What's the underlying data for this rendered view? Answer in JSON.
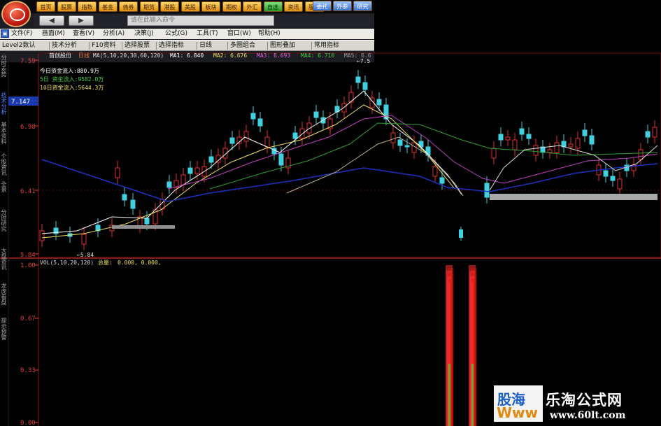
{
  "top_nav": {
    "buttons": [
      "首页",
      "股票",
      "指数",
      "基金",
      "债券",
      "期货",
      "港股",
      "美股",
      "板块",
      "期权",
      "外汇",
      "自选",
      "资讯",
      "服务"
    ],
    "extra_buttons": [
      "委托",
      "外参",
      "研究"
    ]
  },
  "address_bar": {
    "back_label": "◀",
    "forward_label": "▶",
    "command_placeholder": "请在此输入命令"
  },
  "menu": {
    "items": [
      "文件(F)",
      "画面(M)",
      "查看(V)",
      "分析(A)",
      "决策(J)",
      "公式(G)",
      "工具(T)",
      "窗口(W)",
      "帮助(H)"
    ]
  },
  "toolbar": {
    "items": [
      "Level2数认",
      "技术分析",
      "F10资料",
      "选择股票",
      "选择指标",
      "日线",
      "多图组合",
      "图形叠加",
      "常用指标"
    ]
  },
  "side_tabs": [
    "分时走势",
    "技术分析",
    "基本资料",
    "个股资讯",
    "全景",
    "分时研究",
    "大盘资讯",
    "龙虎看盘",
    "提示预警"
  ],
  "price_panel": {
    "stock_name": "首创股份",
    "period": "日线",
    "ma_spec": "MA(5,10,20,30,60,120)",
    "ma_values": [
      {
        "label": "MA1:",
        "value": "6.840",
        "color": "#ffffff"
      },
      {
        "label": "MA2:",
        "value": "6.676",
        "color": "#f0e060"
      },
      {
        "label": "MA3:",
        "value": "6.693",
        "color": "#e060e0"
      },
      {
        "label": "MA4:",
        "value": "6.710",
        "color": "#40d040"
      },
      {
        "label": "MA5:",
        "value": "6.6",
        "color": "#a0a0a0"
      }
    ],
    "fund_flow": [
      {
        "text": "今日资金流入:880.9万",
        "color": "#ffffff"
      },
      {
        "text": "5日 资金流入:9582.0万",
        "color": "#40d040"
      },
      {
        "text": "10日资金流入:5644.3万",
        "color": "#f0e060"
      }
    ],
    "price_axis": [
      "7.59",
      "6.98",
      "6.41",
      "5.84"
    ],
    "current_price": "7.147",
    "high_marker": "7.5",
    "low_marker": "5.84"
  },
  "volume_panel": {
    "spec": "VOL(5,10,20,120)",
    "label": "总量:",
    "values": "0.000, 0.000,",
    "axis": [
      "1.00",
      "0.67",
      "0.33",
      "0.00"
    ]
  },
  "watermark": {
    "logo_top": "股海",
    "logo_bottom": "Www",
    "site_name": "乐淘公式网",
    "url": "www.60lt.com"
  },
  "colors": {
    "up_candle": "#e03030",
    "down_candle": "#40d0e0",
    "axis": "#e04040",
    "ma_white": "#ffffff",
    "ma_yellow": "#f0e060",
    "ma_magenta": "#c040c0",
    "ma_green": "#30a030",
    "ma_blue": "#2030c0"
  }
}
